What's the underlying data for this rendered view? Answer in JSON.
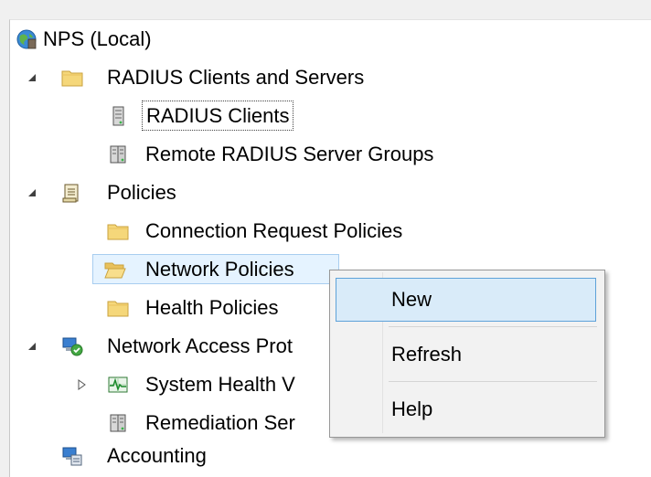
{
  "tree": {
    "root_label": "NPS (Local)",
    "radius_group_label": "RADIUS Clients and Servers",
    "radius_clients_label": "RADIUS Clients",
    "remote_groups_label": "Remote RADIUS Server Groups",
    "policies_label": "Policies",
    "connection_request_label": "Connection Request Policies",
    "network_policies_label": "Network Policies",
    "health_policies_label": "Health Policies",
    "nap_label": "Network Access Prot",
    "shv_label": "System Health V",
    "remediation_label": "Remediation Ser",
    "accounting_label": "Accounting"
  },
  "context_menu": {
    "items": [
      {
        "label": "New"
      },
      {
        "label": "Refresh"
      },
      {
        "label": "Help"
      }
    ]
  },
  "colors": {
    "selection_bg": "#e5f3ff",
    "menu_highlight": "#d9ebf9",
    "menu_highlight_border": "#5ea2d9",
    "folder_yellow": "#f5d77a"
  }
}
